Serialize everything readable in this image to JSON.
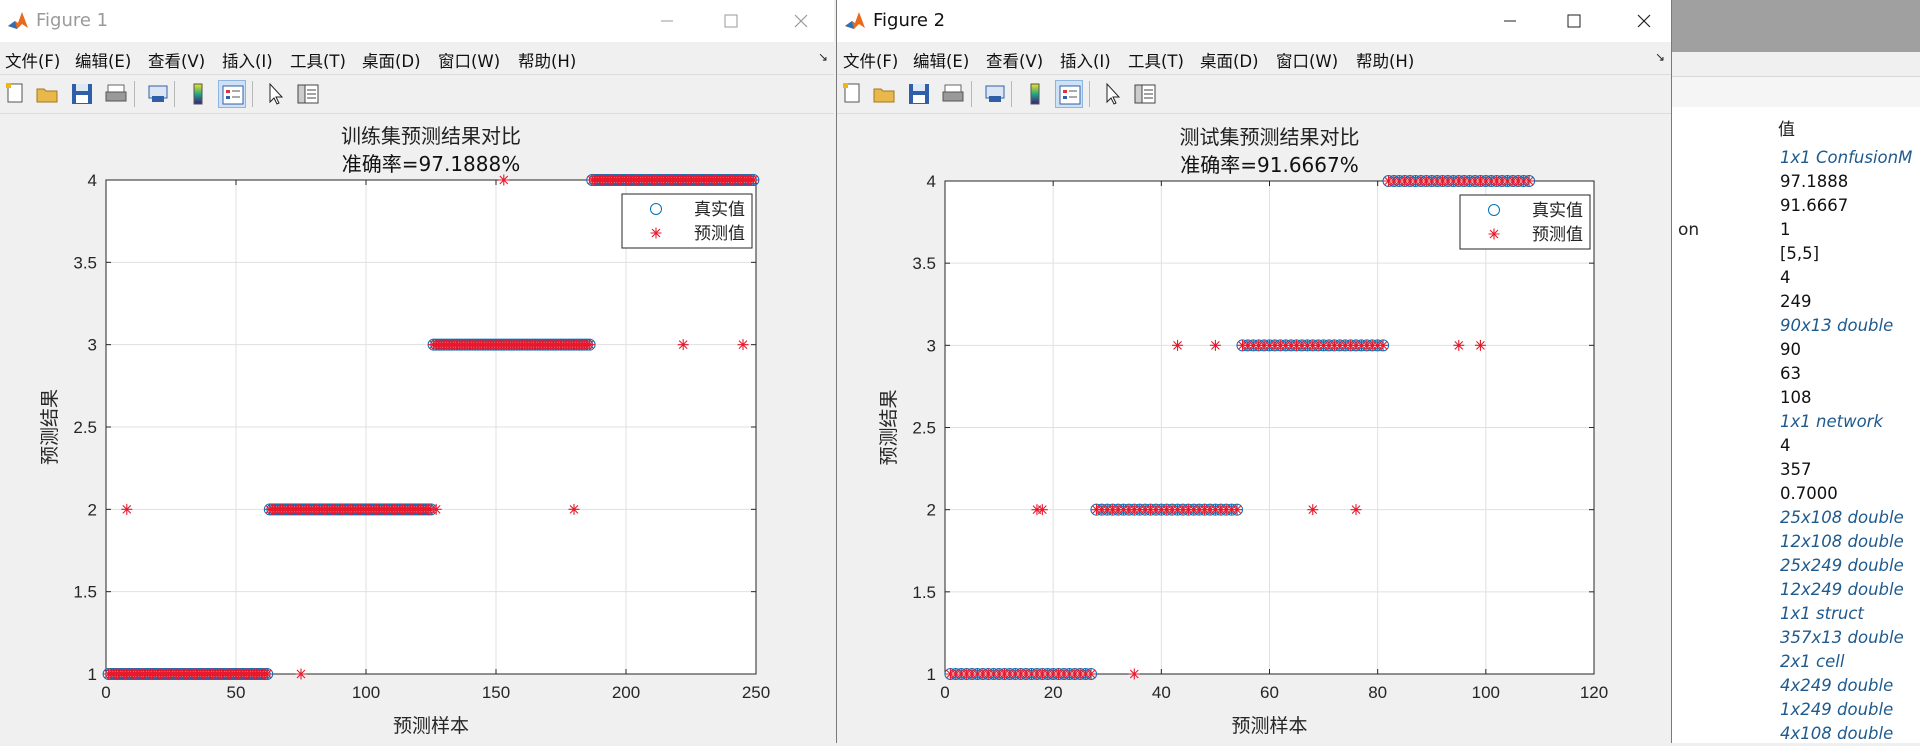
{
  "workspace": {
    "header": "值",
    "partial_name": "on",
    "values": [
      {
        "text": "1x1 ConfusionM",
        "link": true
      },
      {
        "text": "97.1888",
        "link": false
      },
      {
        "text": "91.6667",
        "link": false
      },
      {
        "text": "1",
        "link": false
      },
      {
        "text": "[5,5]",
        "link": false
      },
      {
        "text": "4",
        "link": false
      },
      {
        "text": "249",
        "link": false
      },
      {
        "text": "90x13 double",
        "link": true
      },
      {
        "text": "90",
        "link": false
      },
      {
        "text": "63",
        "link": false
      },
      {
        "text": "108",
        "link": false
      },
      {
        "text": "1x1 network",
        "link": true
      },
      {
        "text": "4",
        "link": false
      },
      {
        "text": "357",
        "link": false
      },
      {
        "text": "0.7000",
        "link": false
      },
      {
        "text": "25x108 double",
        "link": true
      },
      {
        "text": "12x108 double",
        "link": true
      },
      {
        "text": "25x249 double",
        "link": true
      },
      {
        "text": "12x249 double",
        "link": true
      },
      {
        "text": "1x1 struct",
        "link": true
      },
      {
        "text": "357x13 double",
        "link": true
      },
      {
        "text": "2x1 cell",
        "link": true
      },
      {
        "text": "4x249 double",
        "link": true
      },
      {
        "text": "1x249 double",
        "link": true
      },
      {
        "text": "4x108 double",
        "link": true
      }
    ]
  },
  "menus": [
    "文件(F)",
    "编辑(E)",
    "查看(V)",
    "插入(I)",
    "工具(T)",
    "桌面(D)",
    "窗口(W)",
    "帮助(H)"
  ],
  "menu_arrow": "↘",
  "colors": {
    "true_marker": "#0072bd",
    "pred_marker": "#e8192c",
    "grid": "#e0e0e0"
  },
  "figures": [
    {
      "title": "Figure 1",
      "active": false,
      "plot": {
        "title": "训练集预测结果对比",
        "subtitle": "准确率=97.1888%",
        "xlabel": "预测样本",
        "ylabel": "预测结果",
        "xlim": [
          0,
          250
        ],
        "ylim": [
          1,
          4
        ],
        "xticks": [
          0,
          50,
          100,
          150,
          200,
          250
        ],
        "yticks": [
          1,
          1.5,
          2,
          2.5,
          3,
          3.5,
          4
        ],
        "legend": [
          "真实值",
          "预测值"
        ],
        "legend_position": "top-right"
      }
    },
    {
      "title": "Figure 2",
      "active": true,
      "plot": {
        "title": "测试集预测结果对比",
        "subtitle": "准确率=91.6667%",
        "xlabel": "预测样本",
        "ylabel": "预测结果",
        "xlim": [
          0,
          120
        ],
        "ylim": [
          1,
          4
        ],
        "xticks": [
          0,
          20,
          40,
          60,
          80,
          100,
          120
        ],
        "yticks": [
          1,
          1.5,
          2,
          2.5,
          3,
          3.5,
          4
        ],
        "legend": [
          "真实值",
          "预测值"
        ],
        "legend_position": "top-right"
      }
    }
  ],
  "chart_data": [
    {
      "type": "scatter",
      "title": "训练集预测结果对比",
      "subtitle": "准确率=97.1888%",
      "xlabel": "预测样本",
      "ylabel": "预测结果",
      "xlim": [
        0,
        250
      ],
      "ylim": [
        1,
        4
      ],
      "series": [
        {
          "name": "真实值",
          "marker": "circle",
          "segments": [
            {
              "from": 1,
              "to": 62,
              "y": 1
            },
            {
              "from": 63,
              "to": 125,
              "y": 2
            },
            {
              "from": 126,
              "to": 186,
              "y": 3
            },
            {
              "from": 187,
              "to": 249,
              "y": 4
            }
          ]
        },
        {
          "name": "预测值",
          "marker": "star",
          "segments": [
            {
              "from": 1,
              "to": 62,
              "y": 1
            },
            {
              "from": 63,
              "to": 125,
              "y": 2
            },
            {
              "from": 126,
              "to": 186,
              "y": 3
            },
            {
              "from": 187,
              "to": 249,
              "y": 4
            }
          ],
          "outliers": [
            {
              "x": 8,
              "y": 2
            },
            {
              "x": 75,
              "y": 1
            },
            {
              "x": 127,
              "y": 2
            },
            {
              "x": 153,
              "y": 4
            },
            {
              "x": 180,
              "y": 2
            },
            {
              "x": 222,
              "y": 3
            },
            {
              "x": 245,
              "y": 3
            }
          ]
        }
      ]
    },
    {
      "type": "scatter",
      "title": "测试集预测结果对比",
      "subtitle": "准确率=91.6667%",
      "xlabel": "预测样本",
      "ylabel": "预测结果",
      "xlim": [
        0,
        120
      ],
      "ylim": [
        1,
        4
      ],
      "series": [
        {
          "name": "真实值",
          "marker": "circle",
          "segments": [
            {
              "from": 1,
              "to": 27,
              "y": 1
            },
            {
              "from": 28,
              "to": 54,
              "y": 2
            },
            {
              "from": 55,
              "to": 81,
              "y": 3
            },
            {
              "from": 82,
              "to": 108,
              "y": 4
            }
          ]
        },
        {
          "name": "预测值",
          "marker": "star",
          "segments": [
            {
              "from": 1,
              "to": 27,
              "y": 1
            },
            {
              "from": 28,
              "to": 54,
              "y": 2
            },
            {
              "from": 55,
              "to": 81,
              "y": 3
            },
            {
              "from": 82,
              "to": 108,
              "y": 4
            }
          ],
          "outliers": [
            {
              "x": 17,
              "y": 2
            },
            {
              "x": 18,
              "y": 2
            },
            {
              "x": 35,
              "y": 1
            },
            {
              "x": 43,
              "y": 3
            },
            {
              "x": 50,
              "y": 3
            },
            {
              "x": 68,
              "y": 2
            },
            {
              "x": 76,
              "y": 2
            },
            {
              "x": 95,
              "y": 3
            },
            {
              "x": 99,
              "y": 3
            }
          ]
        }
      ]
    }
  ]
}
